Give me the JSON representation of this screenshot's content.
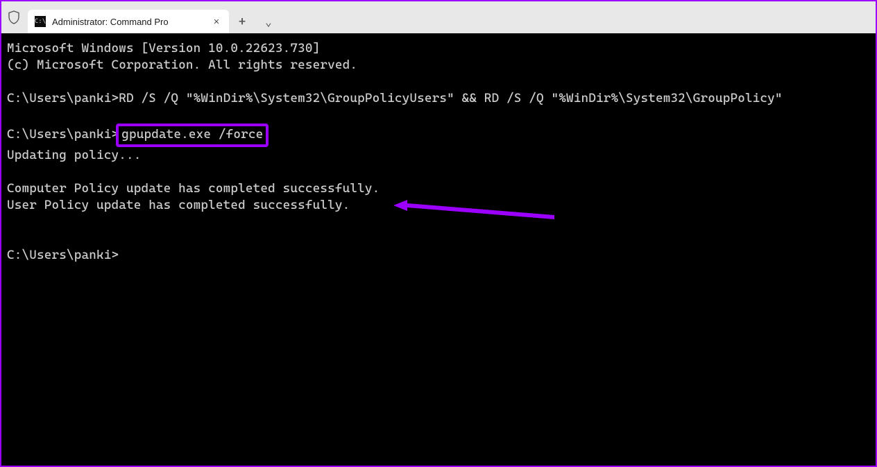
{
  "titlebar": {
    "tab_title": "Administrator: Command Pro",
    "shield_icon": "shield-icon",
    "cmd_icon": "C:\\",
    "close_glyph": "✕",
    "plus_glyph": "+",
    "chevron_glyph": "⌄"
  },
  "terminal": {
    "line1": "Microsoft Windows [Version 10.0.22623.730]",
    "line2": "(c) Microsoft Corporation. All rights reserved.",
    "blank1": "",
    "prompt1": "C:\\Users\\panki>",
    "cmd1": "RD /S /Q \"%WinDir%\\System32\\GroupPolicyUsers\" && RD /S /Q \"%WinDir%\\System32\\GroupPolicy\"",
    "blank2": "",
    "prompt2": "C:\\Users\\panki>",
    "cmd2": "gpupdate.exe /force",
    "line_updating": "Updating policy...",
    "blank3": "",
    "line_comp": "Computer Policy update has completed successfully.",
    "line_user": "User Policy update has completed successfully.",
    "blank4": "",
    "blank5": "",
    "prompt3": "C:\\Users\\panki>"
  }
}
